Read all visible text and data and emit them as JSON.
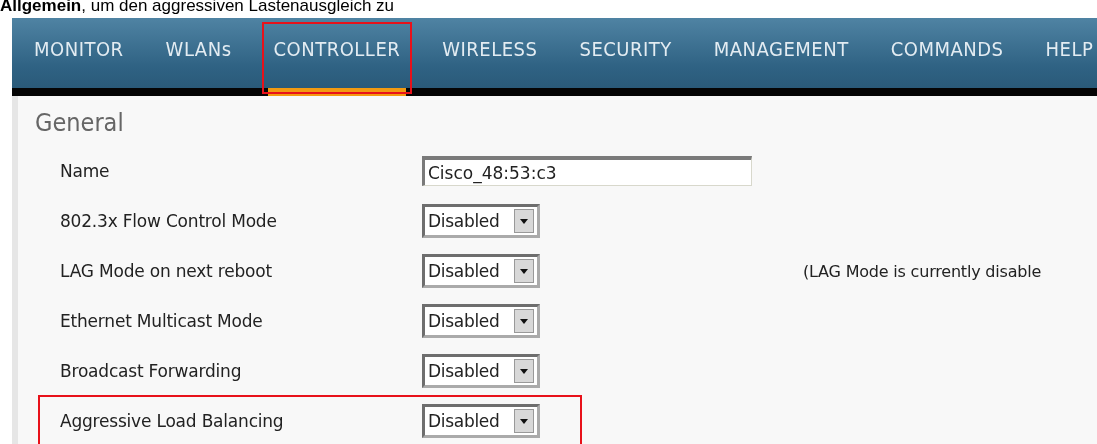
{
  "caption": "**Allgemein**, um den aggressiven Lastenausgleich zu",
  "nav": [
    {
      "label": "MONITOR",
      "selected": false,
      "highlighted": false
    },
    {
      "label": "WLANs",
      "selected": false,
      "highlighted": false
    },
    {
      "label": "CONTROLLER",
      "selected": true,
      "highlighted": true
    },
    {
      "label": "WIRELESS",
      "selected": false,
      "highlighted": false
    },
    {
      "label": "SECURITY",
      "selected": false,
      "highlighted": false
    },
    {
      "label": "MANAGEMENT",
      "selected": false,
      "highlighted": false
    },
    {
      "label": "COMMANDS",
      "selected": false,
      "highlighted": false
    },
    {
      "label": "HELP",
      "selected": false,
      "highlighted": false
    }
  ],
  "section": {
    "title": "General"
  },
  "rows": [
    {
      "label": "Name",
      "kind": "text",
      "value": "Cisco_48:53:c3",
      "highlighted": false
    },
    {
      "label": "802.3x Flow Control Mode",
      "kind": "select",
      "value": "Disabled",
      "highlighted": false
    },
    {
      "label": "LAG Mode on next reboot",
      "kind": "select",
      "value": "Disabled",
      "note": "(LAG Mode is currently disable",
      "highlighted": false
    },
    {
      "label": "Ethernet Multicast Mode",
      "kind": "select",
      "value": "Disabled",
      "highlighted": false
    },
    {
      "label": "Broadcast Forwarding",
      "kind": "select",
      "value": "Disabled",
      "highlighted": false
    },
    {
      "label": "Aggressive Load Balancing",
      "kind": "select",
      "value": "Disabled",
      "highlighted": true
    }
  ]
}
